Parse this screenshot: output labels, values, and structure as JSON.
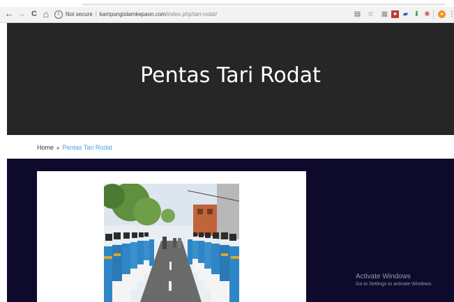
{
  "browser": {
    "nav": {
      "back": "←",
      "forward": "→",
      "reload": "C",
      "home": "⌂"
    },
    "security": "Not secure",
    "url_domain": "kampungislamkepaon.com",
    "url_path": "/index.php/tari-rodat/"
  },
  "page": {
    "title": "Pentas Tari Rodat",
    "breadcrumb": {
      "home": "Home",
      "separator": "»",
      "current": "Pentas Tari Rodat"
    }
  },
  "watermark": {
    "title": "Activate Windows",
    "subtitle": "Go to Settings to activate Windows."
  },
  "colors": {
    "hero_bg": "#262626",
    "content_bg": "#0d0a2c",
    "breadcrumb_link": "#4aa3df",
    "costume_blue": "#2f86c6"
  }
}
